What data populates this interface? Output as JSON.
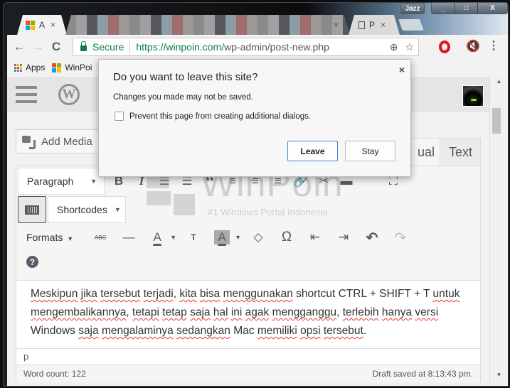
{
  "window": {
    "user_badge": "Jazz",
    "minimize": "_",
    "maximize": "□",
    "close": "X"
  },
  "tabs": [
    {
      "label": "A",
      "icon": "microsoft-icon",
      "close": "×",
      "active": true
    },
    {
      "label": "",
      "icon": "blurred",
      "close": "×",
      "active": false
    },
    {
      "label": "P",
      "icon": "page-icon",
      "close": "×",
      "active": false
    }
  ],
  "toolbar": {
    "back": "←",
    "forward": "→",
    "reload": "C",
    "secure_label": "Secure",
    "url_host": "https://winpoin.com",
    "url_path": "/wp-admin/post-new.php",
    "zoom_icon": "⊕",
    "star_icon": "☆",
    "menu_icon": "⋮",
    "mute_icon": "🔇"
  },
  "bookmarks": [
    {
      "label": "Apps",
      "icon": "apps-grid-icon"
    },
    {
      "label": "WinPoi",
      "icon": "microsoft-icon"
    }
  ],
  "wp": {
    "logo": "W",
    "add_media": "Add Media",
    "tab_visual": "Visual",
    "tab_visual_visible": "ual",
    "tab_text": "Text",
    "toolbar1": {
      "format_select": "Paragraph",
      "bold": "B",
      "italic": "I",
      "bullet_list": "☰",
      "numbered_list": "☰",
      "blockquote": "“",
      "align_left": "≡",
      "align_center": "≡",
      "align_right": "≡",
      "link": "🔗",
      "unlink": "✂",
      "read_more": "▬",
      "fullscreen": "⛶"
    },
    "toolbar2": {
      "shortcodes_select": "Shortcodes"
    },
    "toolbar3": {
      "formats": "Formats",
      "strikethrough": "ABC",
      "hr": "—",
      "text_color": "A",
      "paste_text": "T",
      "bg_color": "A",
      "clear_formatting": "◇",
      "special_char": "Ω",
      "outdent": "⇤",
      "indent": "⇥",
      "undo": "↶",
      "redo": "↷",
      "help": "?"
    },
    "content": {
      "segments": [
        {
          "t": "Meskipun",
          "s": true
        },
        {
          "t": " ",
          "s": false
        },
        {
          "t": "jika",
          "s": true
        },
        {
          "t": " ",
          "s": false
        },
        {
          "t": "tersebut",
          "s": true
        },
        {
          "t": " ",
          "s": false
        },
        {
          "t": "terjadi",
          "s": true
        },
        {
          "t": ", ",
          "s": false
        },
        {
          "t": "kita",
          "s": true
        },
        {
          "t": " ",
          "s": false
        },
        {
          "t": "bisa",
          "s": true
        },
        {
          "t": " ",
          "s": false
        },
        {
          "t": "menggunakan",
          "s": true
        },
        {
          "t": " shortcut CTRL + SHIFT + T ",
          "s": false
        },
        {
          "t": "untuk",
          "s": true
        },
        {
          "t": " ",
          "s": false
        },
        {
          "t": "mengembalikannya",
          "s": true
        },
        {
          "t": ", ",
          "s": false
        },
        {
          "t": "tetapi",
          "s": true
        },
        {
          "t": " ",
          "s": false
        },
        {
          "t": "tetap",
          "s": true
        },
        {
          "t": " ",
          "s": false
        },
        {
          "t": "saja",
          "s": true
        },
        {
          "t": " ",
          "s": false
        },
        {
          "t": "hal",
          "s": true
        },
        {
          "t": " ",
          "s": false
        },
        {
          "t": "ini",
          "s": true
        },
        {
          "t": " ",
          "s": false
        },
        {
          "t": "agak",
          "s": true
        },
        {
          "t": " ",
          "s": false
        },
        {
          "t": "mengganggu",
          "s": true
        },
        {
          "t": ", ",
          "s": false
        },
        {
          "t": "terlebih",
          "s": true
        },
        {
          "t": " ",
          "s": false
        },
        {
          "t": "hanya",
          "s": true
        },
        {
          "t": " ",
          "s": false
        },
        {
          "t": "versi",
          "s": true
        },
        {
          "t": " Windows ",
          "s": false
        },
        {
          "t": "saja",
          "s": true
        },
        {
          "t": " ",
          "s": false
        },
        {
          "t": "mengalaminya",
          "s": true
        },
        {
          "t": " ",
          "s": false
        },
        {
          "t": "sedangkan",
          "s": true
        },
        {
          "t": " Mac ",
          "s": false
        },
        {
          "t": "memiliki",
          "s": true
        },
        {
          "t": " ",
          "s": false
        },
        {
          "t": "opsi",
          "s": true
        },
        {
          "t": " ",
          "s": false
        },
        {
          "t": "tersebut",
          "s": true
        },
        {
          "t": ".",
          "s": false
        }
      ]
    },
    "path": "p",
    "word_count": "Word count: 122",
    "draft_status": "Draft saved at 8:13:43 pm."
  },
  "watermark": {
    "title": "WinPoin",
    "subtitle": "#1 Windows Portal Indonesia"
  },
  "dialog": {
    "title": "Do you want to leave this site?",
    "message": "Changes you made may not be saved.",
    "checkbox_label": "Prevent this page from creating additional dialogs.",
    "checkbox_checked": false,
    "leave_label": "Leave",
    "stay_label": "Stay",
    "close": "×"
  },
  "colors": {
    "secure_green": "#0b8043",
    "dialog_focus_blue": "#4d7ed8",
    "opera_red": "#e0161e",
    "wp_bar": "#e5e5e5"
  }
}
